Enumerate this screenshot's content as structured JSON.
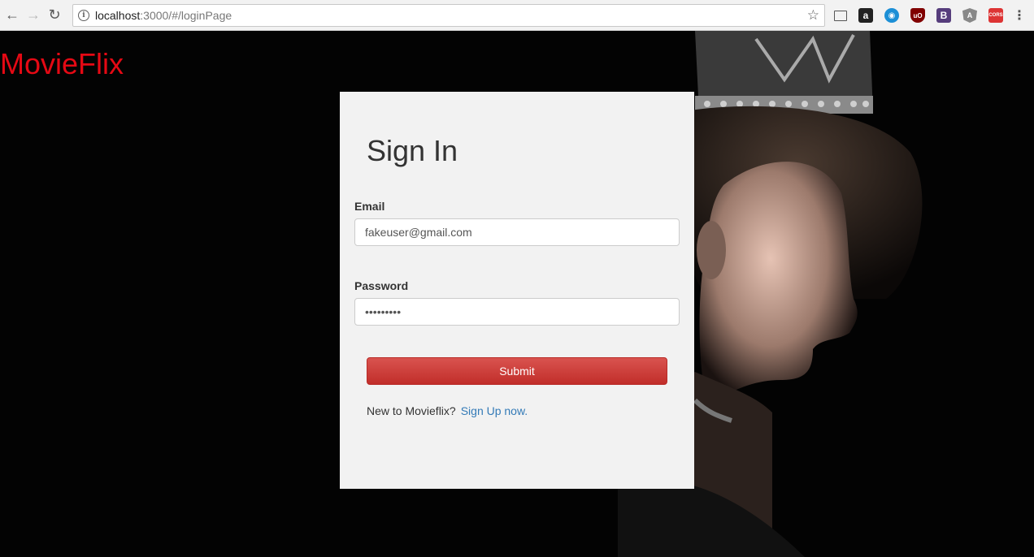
{
  "browser": {
    "url_host": "localhost",
    "url_rest": ":3000/#/loginPage",
    "extensions": [
      {
        "name": "cast-icon",
        "glyph": ""
      },
      {
        "name": "amazon-extension-icon",
        "glyph": "a"
      },
      {
        "name": "eye-extension-icon",
        "glyph": "◉"
      },
      {
        "name": "ublock-icon",
        "glyph": "uO"
      },
      {
        "name": "bootstrap-extension-icon",
        "glyph": "B"
      },
      {
        "name": "angular-extension-icon",
        "glyph": "A"
      },
      {
        "name": "cors-extension-icon",
        "glyph": "CORS"
      }
    ]
  },
  "brand": {
    "name": "MovieFlix",
    "color": "#e50914"
  },
  "signin": {
    "title": "Sign In",
    "email_label": "Email",
    "email_value": "fakeuser@gmail.com",
    "password_label": "Password",
    "password_value": "•••••••••",
    "submit_label": "Submit",
    "signup_prompt": "New to Movieflix?",
    "signup_link": "Sign Up now."
  }
}
